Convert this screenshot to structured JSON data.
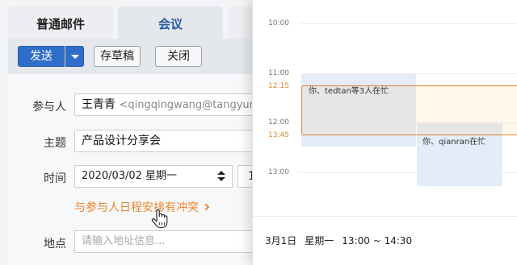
{
  "tabs": [
    {
      "label": "普通邮件",
      "active": false
    },
    {
      "label": "会议",
      "active": true
    }
  ],
  "toolbar": {
    "send_label": "发送",
    "draft_label": "存草稿",
    "close_label": "关闭"
  },
  "form": {
    "attendee_label": "参与人",
    "attendee_name": "王青青",
    "attendee_email": "<qingqingwang@tangyun",
    "subject_label": "主题",
    "subject_value": "产品设计分享会",
    "time_label": "时间",
    "date_value": "2020/03/02 星期一",
    "hour_value": "1",
    "conflict_text": "与参与人日程安排有冲突",
    "location_label": "地点",
    "location_placeholder": "请输入地址信息..."
  },
  "calendar": {
    "times": [
      "10:00",
      "11:00",
      "12:15",
      "12:00",
      "13:45",
      "13:00"
    ],
    "busy_a_text": "你、tedtan等3人在忙",
    "busy_b_text": "你、qianran在忙",
    "footer_date": "3月1日",
    "footer_weekday": "星期一",
    "footer_range": "13:00 ~ 14:30"
  },
  "colors": {
    "accent_blue": "#2f6ec8",
    "conflict_orange": "#e8852a",
    "busy_fill": "#e3ecf8"
  },
  "icons": [
    "chevron-down-icon",
    "sort-arrows-icon",
    "chevron-right-icon",
    "hand-pointer-icon"
  ]
}
